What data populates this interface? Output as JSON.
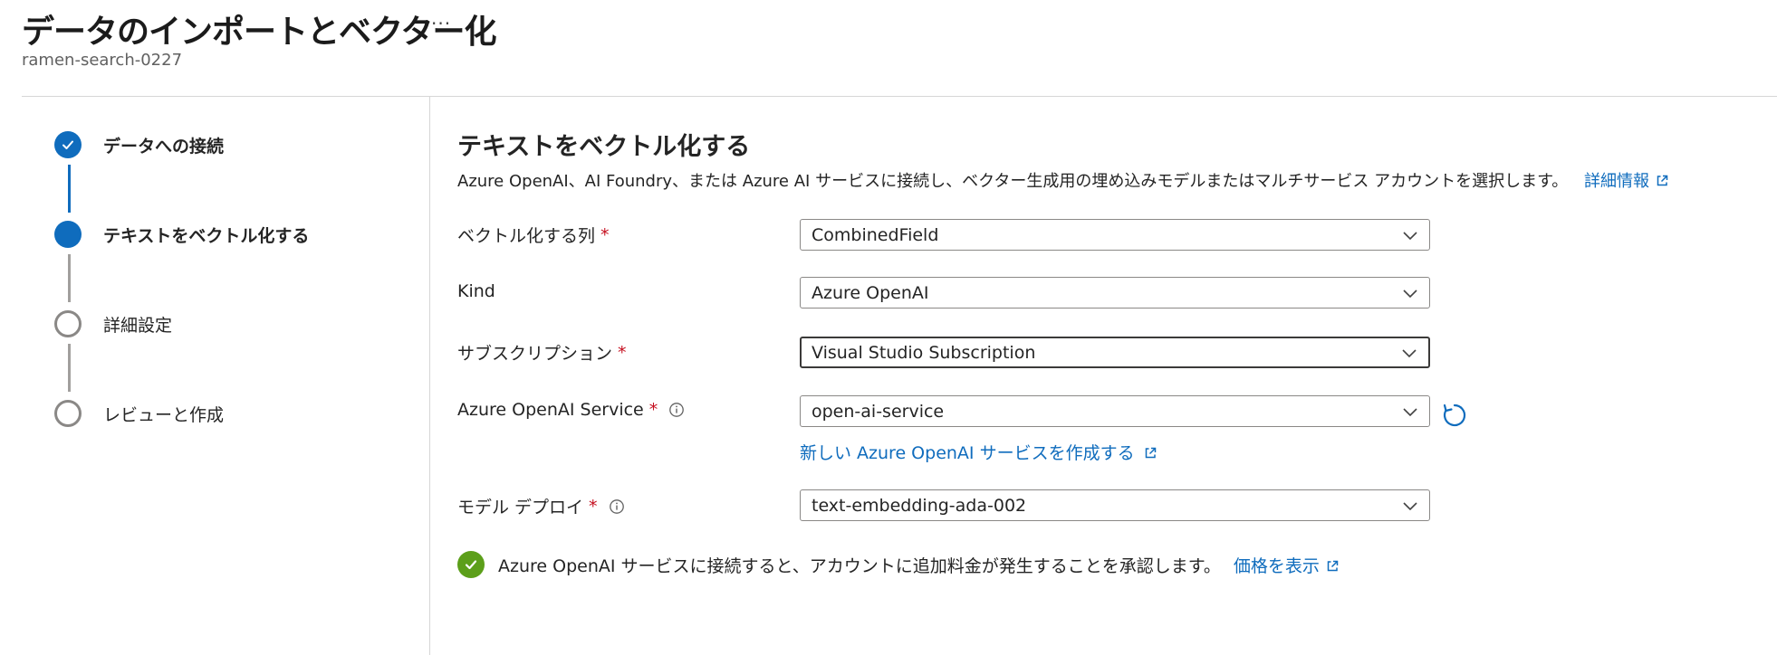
{
  "header": {
    "title": "データのインポートとベクター化",
    "more_label": "···",
    "subtitle": "ramen-search-0227"
  },
  "steps": [
    {
      "label": "データへの接続",
      "state": "completed"
    },
    {
      "label": "テキストをベクトル化する",
      "state": "current"
    },
    {
      "label": "詳細設定",
      "state": "pending"
    },
    {
      "label": "レビューと作成",
      "state": "pending"
    }
  ],
  "main": {
    "title": "テキストをベクトル化する",
    "description": "Azure OpenAI、AI Foundry、または Azure AI サービスに接続し、ベクター生成用の埋め込みモデルまたはマルチサービス アカウントを選択します。",
    "learn_more": "詳細情報",
    "fields": {
      "column": {
        "label": "ベクトル化する列",
        "required": "*",
        "value": "CombinedField"
      },
      "kind": {
        "label": "Kind",
        "value": "Azure OpenAI"
      },
      "subscription": {
        "label": "サブスクリプション",
        "required": "*",
        "value": "Visual Studio Subscription"
      },
      "service": {
        "label": "Azure OpenAI Service",
        "required": "*",
        "value": "open-ai-service"
      },
      "deployment": {
        "label": "モデル デプロイ",
        "required": "*",
        "value": "text-embedding-ada-002"
      }
    },
    "create_service_link": "新しい Azure OpenAI サービスを作成する",
    "acknowledge_text": "Azure OpenAI サービスに接続すると、アカウントに追加料金が発生することを承認します。",
    "pricing_link": "価格を表示"
  },
  "colors": {
    "accent": "#0f6cbd",
    "required": "#c50f1f",
    "success": "#5c9f1a"
  }
}
